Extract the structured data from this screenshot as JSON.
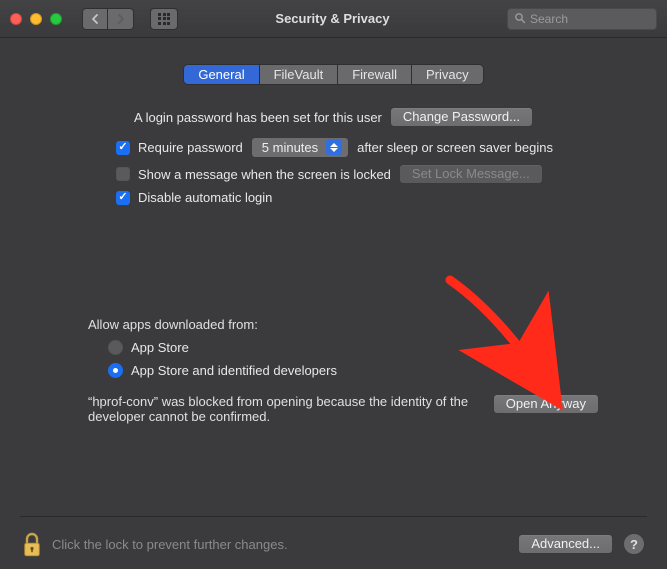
{
  "window": {
    "title": "Security & Privacy",
    "search_placeholder": "Search"
  },
  "tabs": [
    {
      "label": "General",
      "active": true
    },
    {
      "label": "FileVault",
      "active": false
    },
    {
      "label": "Firewall",
      "active": false
    },
    {
      "label": "Privacy",
      "active": false
    }
  ],
  "general": {
    "password_set_text": "A login password has been set for this user",
    "change_password_btn": "Change Password...",
    "require_password_label": "Require password",
    "require_password_checked": true,
    "delay_select_value": "5 minutes",
    "after_sleep_text": "after sleep or screen saver begins",
    "show_message_label": "Show a message when the screen is locked",
    "show_message_checked": false,
    "set_lock_message_btn": "Set Lock Message...",
    "disable_auto_login_label": "Disable automatic login",
    "disable_auto_login_checked": true
  },
  "allow_apps": {
    "header": "Allow apps downloaded from:",
    "options": [
      {
        "label": "App Store",
        "selected": false
      },
      {
        "label": "App Store and identified developers",
        "selected": true
      }
    ],
    "blocked_message": "“hprof-conv” was blocked from opening because the identity of the developer cannot be confirmed.",
    "open_anyway_btn": "Open Anyway"
  },
  "footer": {
    "lock_text": "Click the lock to prevent further changes.",
    "advanced_btn": "Advanced...",
    "help_label": "?"
  },
  "annotation": {
    "arrow_color": "#ff2a1a"
  }
}
